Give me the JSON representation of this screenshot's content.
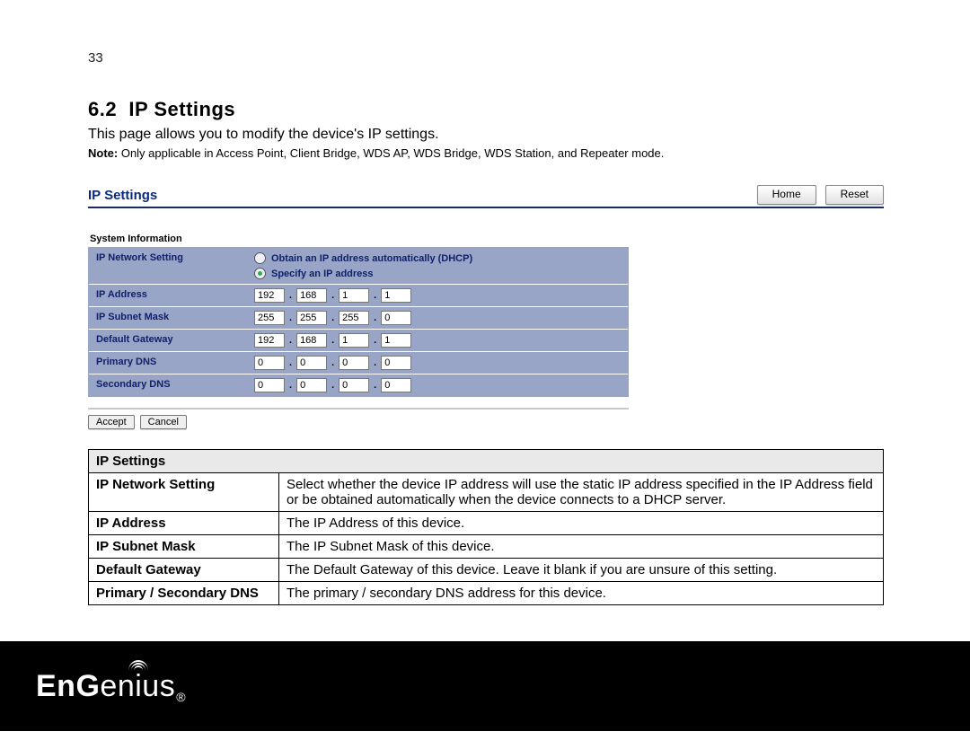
{
  "page_number": "33",
  "section": {
    "number": "6.2",
    "title": "IP Settings"
  },
  "lead": "This page allows you to modify the device's IP settings.",
  "note_label": "Note:",
  "note_text": " Only applicable in Access Point, Client Bridge, WDS AP, WDS Bridge, WDS Station, and Repeater mode.",
  "panel": {
    "title": "IP Settings",
    "home": "Home",
    "reset": "Reset",
    "subhead": "System Information",
    "rows": {
      "net_setting": {
        "label": "IP Network Setting",
        "opt1": "Obtain an IP address automatically (DHCP)",
        "opt2": "Specify an IP address",
        "selected": "opt2"
      },
      "ip_address": {
        "label": "IP Address",
        "o": [
          "192",
          "168",
          "1",
          "1"
        ]
      },
      "subnet": {
        "label": "IP Subnet Mask",
        "o": [
          "255",
          "255",
          "255",
          "0"
        ]
      },
      "gateway": {
        "label": "Default Gateway",
        "o": [
          "192",
          "168",
          "1",
          "1"
        ]
      },
      "pdns": {
        "label": "Primary DNS",
        "o": [
          "0",
          "0",
          "0",
          "0"
        ]
      },
      "sdns": {
        "label": "Secondary DNS",
        "o": [
          "0",
          "0",
          "0",
          "0"
        ]
      }
    },
    "accept": "Accept",
    "cancel": "Cancel"
  },
  "doc_table": {
    "header": "IP Settings",
    "rows": [
      {
        "k": "IP Network Setting",
        "v": "Select whether the device IP address will use the static IP address specified in the IP Address field or be obtained automatically when the device connects to a DHCP server."
      },
      {
        "k": "IP Address",
        "v": "The IP Address of this device."
      },
      {
        "k": "IP Subnet Mask",
        "v": "The IP Subnet Mask of this device."
      },
      {
        "k": "Default Gateway",
        "v": "The Default Gateway of this device. Leave it blank if you are unsure of this setting."
      },
      {
        "k": "Primary / Secondary DNS",
        "v": "The primary / secondary DNS address for this device."
      }
    ]
  },
  "brand": "EnGenius"
}
